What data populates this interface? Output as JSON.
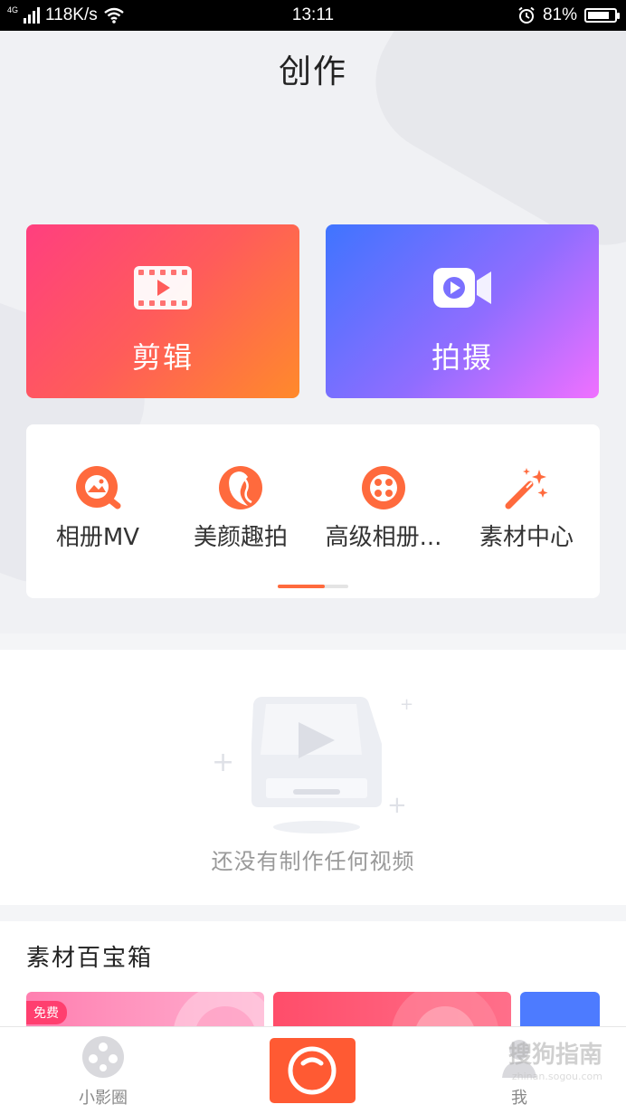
{
  "status_bar": {
    "network": "4G",
    "speed": "118K/s",
    "time": "13:11",
    "battery": "81%",
    "battery_level": 0.81
  },
  "page": {
    "title": "创作"
  },
  "main_actions": [
    {
      "label": "剪辑",
      "icon": "film-icon"
    },
    {
      "label": "拍摄",
      "icon": "video-camera-icon"
    }
  ],
  "tools": [
    {
      "label": "相册MV",
      "icon": "album-mv-icon"
    },
    {
      "label": "美颜趣拍",
      "icon": "beauty-face-icon"
    },
    {
      "label": "高级相册...",
      "icon": "film-reel-icon"
    },
    {
      "label": "素材中心",
      "icon": "magic-wand-icon"
    }
  ],
  "pager": {
    "pages": 2,
    "active": 1
  },
  "empty_state": {
    "text": "还没有制作任何视频",
    "icon": "empty-inbox-icon"
  },
  "toolbox": {
    "title": "素材百宝箱",
    "items": [
      {
        "badge": "免费"
      },
      {
        "badge": ""
      },
      {
        "badge": ""
      }
    ]
  },
  "tab_bar": {
    "tabs": [
      {
        "label": "小影圈",
        "icon": "film-reel-tab-icon"
      },
      {
        "label": "",
        "icon": "camera-shutter-icon"
      },
      {
        "label": "我",
        "icon": "user-icon"
      }
    ]
  },
  "watermark": {
    "text": "搜狗指南",
    "sub": "zhinan.sogou.com"
  },
  "colors": {
    "accent": "#ff5a33",
    "edit_gradient": [
      "#ff3f7f",
      "#ff8a2b"
    ],
    "shoot_gradient": [
      "#3f74ff",
      "#f070ff"
    ]
  }
}
